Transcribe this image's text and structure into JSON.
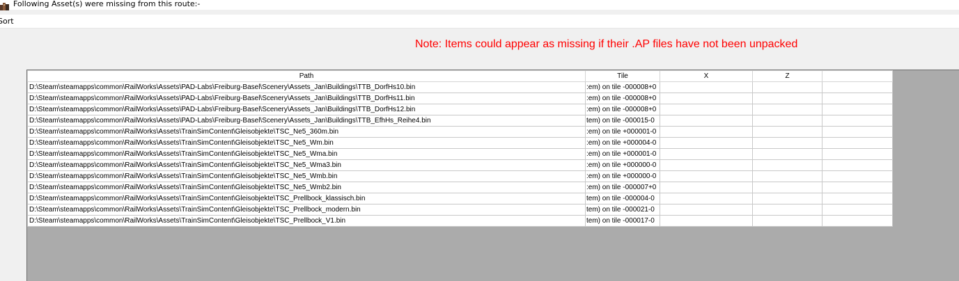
{
  "window": {
    "title": "Following Asset(s) were missing from this route:-",
    "icon": "app-icon"
  },
  "menu": {
    "items": [
      {
        "label": "Sort"
      }
    ]
  },
  "note": "Note: Items could appear as missing if their .AP files have not been unpacked",
  "table": {
    "columns": [
      "Path",
      "Tile",
      "X",
      "Z",
      ""
    ],
    "rows": [
      {
        "path": "D:\\Steam\\steamapps\\common\\RailWorks\\Assets\\PAD-Labs\\Freiburg-Basel\\Scenery\\Assets_Jan\\Buildings\\TTB_DorfHs10.bin",
        "tile": ":em) on tile -000008+0",
        "x": "",
        "z": ""
      },
      {
        "path": "D:\\Steam\\steamapps\\common\\RailWorks\\Assets\\PAD-Labs\\Freiburg-Basel\\Scenery\\Assets_Jan\\Buildings\\TTB_DorfHs11.bin",
        "tile": ":em) on tile -000008+0",
        "x": "",
        "z": ""
      },
      {
        "path": "D:\\Steam\\steamapps\\common\\RailWorks\\Assets\\PAD-Labs\\Freiburg-Basel\\Scenery\\Assets_Jan\\Buildings\\TTB_DorfHs12.bin",
        "tile": ":em) on tile -000008+0",
        "x": "",
        "z": ""
      },
      {
        "path": "D:\\Steam\\steamapps\\common\\RailWorks\\Assets\\PAD-Labs\\Freiburg-Basel\\Scenery\\Assets_Jan\\Buildings\\TTB_EfhHs_Reihe4.bin",
        "tile": "tem) on tile -000015-0",
        "x": "",
        "z": ""
      },
      {
        "path": "D:\\Steam\\steamapps\\common\\RailWorks\\Assets\\TrainSimContent\\Gleisobjekte\\TSC_Ne5_360m.bin",
        "tile": ":em) on tile +000001-0",
        "x": "",
        "z": ""
      },
      {
        "path": "D:\\Steam\\steamapps\\common\\RailWorks\\Assets\\TrainSimContent\\Gleisobjekte\\TSC_Ne5_Wm.bin",
        "tile": ":em) on tile +000004-0",
        "x": "",
        "z": ""
      },
      {
        "path": "D:\\Steam\\steamapps\\common\\RailWorks\\Assets\\TrainSimContent\\Gleisobjekte\\TSC_Ne5_Wma.bin",
        "tile": ":em) on tile +000001-0",
        "x": "",
        "z": ""
      },
      {
        "path": "D:\\Steam\\steamapps\\common\\RailWorks\\Assets\\TrainSimContent\\Gleisobjekte\\TSC_Ne5_Wma3.bin",
        "tile": ":em) on tile +000000-0",
        "x": "",
        "z": ""
      },
      {
        "path": "D:\\Steam\\steamapps\\common\\RailWorks\\Assets\\TrainSimContent\\Gleisobjekte\\TSC_Ne5_Wmb.bin",
        "tile": ":em) on tile +000000-0",
        "x": "",
        "z": ""
      },
      {
        "path": "D:\\Steam\\steamapps\\common\\RailWorks\\Assets\\TrainSimContent\\Gleisobjekte\\TSC_Ne5_Wmb2.bin",
        "tile": ":em) on tile -000007+0",
        "x": "",
        "z": ""
      },
      {
        "path": "D:\\Steam\\steamapps\\common\\RailWorks\\Assets\\TrainSimContent\\Gleisobjekte\\TSC_Prellbock_klassisch.bin",
        "tile": "tem) on tile -000004-0",
        "x": "",
        "z": ""
      },
      {
        "path": "D:\\Steam\\steamapps\\common\\RailWorks\\Assets\\TrainSimContent\\Gleisobjekte\\TSC_Prellbock_modern.bin",
        "tile": "tem) on tile -000021-0",
        "x": "",
        "z": ""
      },
      {
        "path": "D:\\Steam\\steamapps\\common\\RailWorks\\Assets\\TrainSimContent\\Gleisobjekte\\TSC_Prellbock_V1.bin",
        "tile": "tem) on tile -000017-0",
        "x": "",
        "z": ""
      }
    ]
  },
  "colors": {
    "note": "#ff0000",
    "grid_background": "#ababab",
    "window_background": "#f0f0f0"
  }
}
